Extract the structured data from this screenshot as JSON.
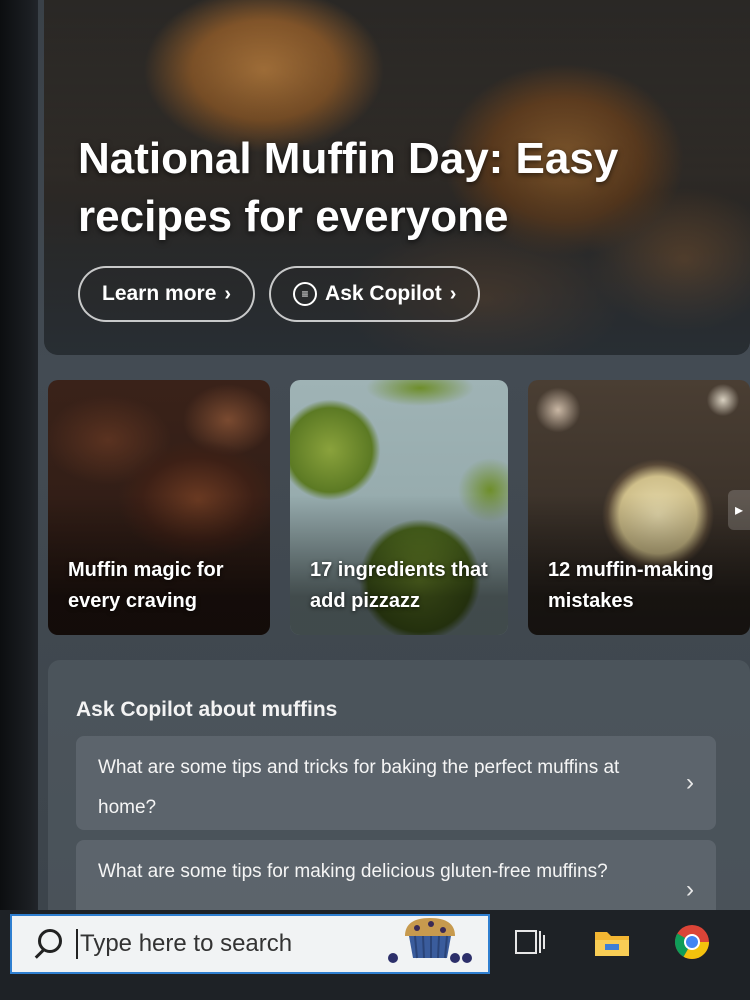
{
  "hero": {
    "title": "National Muffin Day: Easy recipes for everyone",
    "learn_more_label": "Learn more",
    "ask_copilot_label": "Ask Copilot"
  },
  "cards": [
    {
      "label": "Muffin magic for every craving"
    },
    {
      "label": "17 ingredients that add pizzazz"
    },
    {
      "label": "12 muffin-making mistakes"
    }
  ],
  "ask_section": {
    "title": "Ask Copilot about muffins",
    "questions": [
      "What are some tips and tricks for baking the perfect muffins at home?",
      "What are some tips for making delicious gluten-free muffins?"
    ]
  },
  "taskbar": {
    "search_placeholder": "Type here to search",
    "icons": [
      "search-icon",
      "muffin-highlight-icon",
      "task-view-icon",
      "file-explorer-icon",
      "chrome-icon"
    ]
  },
  "colors": {
    "panel_bg": "#434b53",
    "taskbar_bg": "#1e2226",
    "search_border": "#2f7fd0"
  }
}
